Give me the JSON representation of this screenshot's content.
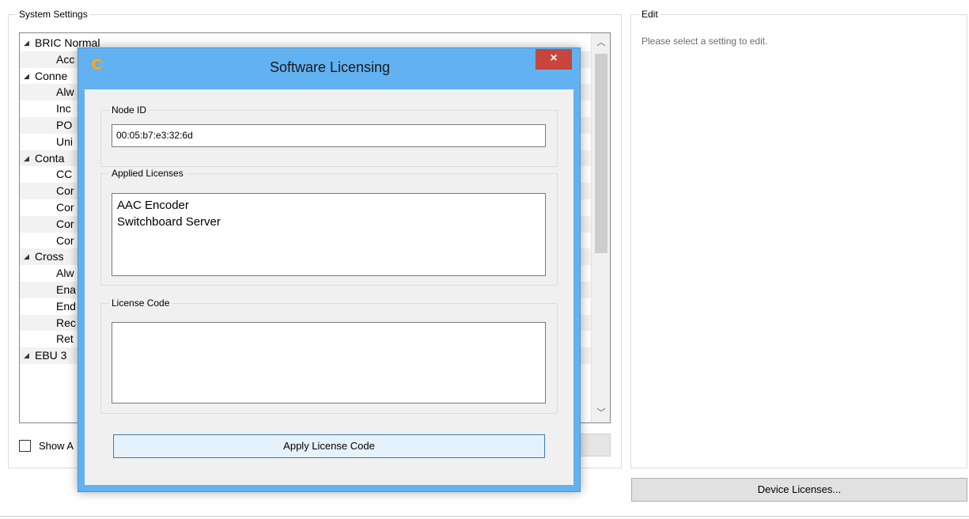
{
  "system_settings": {
    "title": "System Settings",
    "tree_items": [
      {
        "label": "BRIC Normal",
        "type": "group"
      },
      {
        "label": "Acc",
        "type": "child"
      },
      {
        "label": "Conne",
        "type": "group"
      },
      {
        "label": "Alw",
        "type": "child"
      },
      {
        "label": "Inc",
        "type": "child"
      },
      {
        "label": "PO",
        "type": "child"
      },
      {
        "label": "Uni",
        "type": "child"
      },
      {
        "label": "Conta",
        "type": "group"
      },
      {
        "label": "CC",
        "type": "child"
      },
      {
        "label": "Cor",
        "type": "child"
      },
      {
        "label": "Cor",
        "type": "child"
      },
      {
        "label": "Cor",
        "type": "child"
      },
      {
        "label": "Cor",
        "type": "child"
      },
      {
        "label": "Cross",
        "type": "group"
      },
      {
        "label": "Alw",
        "type": "child"
      },
      {
        "label": "Ena",
        "type": "child"
      },
      {
        "label": "End",
        "type": "child"
      },
      {
        "label": "Rec",
        "type": "child"
      },
      {
        "label": "Ret",
        "type": "child"
      },
      {
        "label": "EBU 3",
        "type": "group"
      }
    ],
    "show_all_label": "Show A"
  },
  "edit": {
    "title": "Edit",
    "hint": "Please select a setting to edit."
  },
  "device_licenses_button": "Device Licenses...",
  "dialog": {
    "title": "Software Licensing",
    "close_glyph": "×",
    "node_id": {
      "label": "Node ID",
      "value": "00:05:b7:e3:32:6d"
    },
    "applied_licenses": {
      "label": "Applied Licenses",
      "items": [
        "AAC Encoder",
        "Switchboard Server"
      ]
    },
    "license_code": {
      "label": "License Code",
      "value": ""
    },
    "apply_button": "Apply License Code"
  }
}
